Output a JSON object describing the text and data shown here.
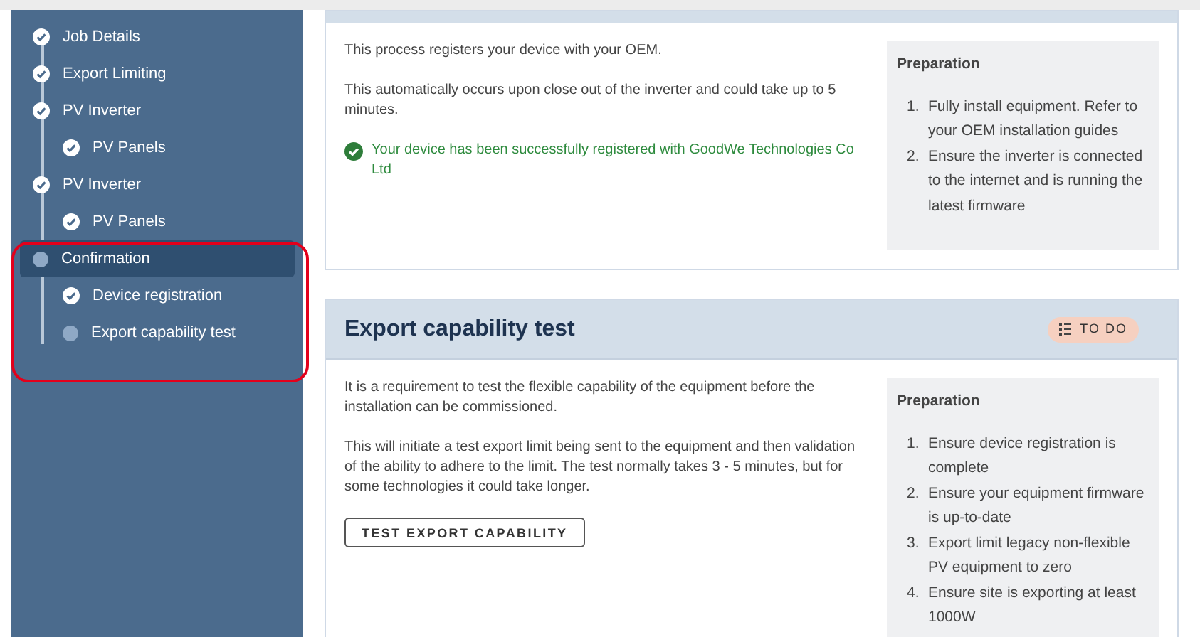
{
  "sidebar": {
    "steps": [
      {
        "label": "Job Details",
        "done": true,
        "selected": false
      },
      {
        "label": "Export Limiting",
        "done": true,
        "selected": false
      },
      {
        "label": "PV Inverter",
        "done": true,
        "selected": false,
        "children": [
          {
            "label": "PV Panels",
            "done": true,
            "selected": false
          }
        ]
      },
      {
        "label": "PV Inverter",
        "done": true,
        "selected": false,
        "children": [
          {
            "label": "PV Panels",
            "done": true,
            "selected": false
          }
        ]
      },
      {
        "label": "Confirmation",
        "done": false,
        "selected": true,
        "children": [
          {
            "label": "Device registration",
            "done": true,
            "selected": false
          },
          {
            "label": "Export capability test",
            "done": false,
            "selected": false
          }
        ]
      }
    ]
  },
  "cards": [
    {
      "paragraphs": [
        "This process registers your device with your OEM.",
        "This automatically occurs upon close out of the inverter and could take up to 5 minutes."
      ],
      "success": "Your device has been successfully registered with GoodWe Technologies Co Ltd",
      "preparation": {
        "title": "Preparation",
        "items": [
          {
            "number": "1.",
            "text": "Fully install equipment. Refer to your OEM installation guides"
          },
          {
            "number": "2.",
            "text": "Ensure the inverter is connected to the internet and is running the latest firmware"
          }
        ]
      }
    },
    {
      "title": "Export capability test",
      "badge": "TO DO",
      "paragraphs": [
        "It is a requirement to test the flexible capability of the equipment before the installation can be commissioned.",
        "This will initiate a test export limit being sent to the equipment and then validation of the ability to adhere to the limit. The test normally takes 3 - 5 minutes, but for some technologies it could take longer."
      ],
      "button": "TEST EXPORT CAPABILITY",
      "preparation": {
        "title": "Preparation",
        "items": [
          {
            "number": "1.",
            "text": "Ensure device registration is complete"
          },
          {
            "number": "2.",
            "text": "Ensure your equipment firmware is up-to-date"
          },
          {
            "number": "3.",
            "text": "Export limit legacy non-flexible PV equipment to zero"
          },
          {
            "number": "4.",
            "text": "Ensure site is exporting at least 1000W"
          }
        ]
      }
    }
  ]
}
